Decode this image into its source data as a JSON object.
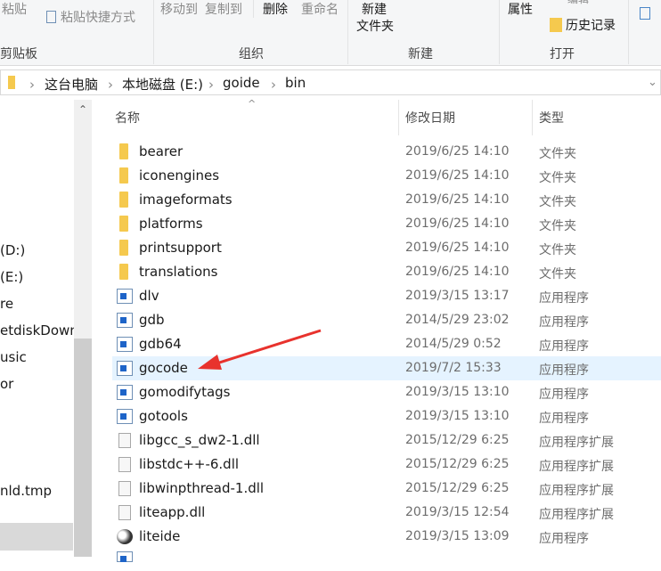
{
  "ribbon": {
    "paste": "粘贴",
    "paste_shortcut": "粘贴快捷方式",
    "move_to": "移动到",
    "copy_to": "复制到",
    "delete": "删除",
    "rename": "重命名",
    "new_folder_1": "新建",
    "new_folder_2": "文件夹",
    "properties": "属性",
    "edit": "编辑",
    "history": "历史记录",
    "groups": {
      "clipboard": "剪贴板",
      "organize": "组织",
      "new": "新建",
      "open": "打开"
    }
  },
  "address": {
    "crumbs": [
      "这台电脑",
      "本地磁盘 (E:)",
      "goide",
      "bin"
    ]
  },
  "nav": {
    "items": [
      "(D:)",
      "(E:)",
      "re",
      "etdiskDown",
      "usic",
      "or",
      "nld.tmp"
    ]
  },
  "columns": {
    "name": "名称",
    "date": "修改日期",
    "type": "类型"
  },
  "files": [
    {
      "name": "bearer",
      "date": "2019/6/25 14:10",
      "type": "文件夹",
      "icon": "folder"
    },
    {
      "name": "iconengines",
      "date": "2019/6/25 14:10",
      "type": "文件夹",
      "icon": "folder"
    },
    {
      "name": "imageformats",
      "date": "2019/6/25 14:10",
      "type": "文件夹",
      "icon": "folder"
    },
    {
      "name": "platforms",
      "date": "2019/6/25 14:10",
      "type": "文件夹",
      "icon": "folder"
    },
    {
      "name": "printsupport",
      "date": "2019/6/25 14:10",
      "type": "文件夹",
      "icon": "folder"
    },
    {
      "name": "translations",
      "date": "2019/6/25 14:10",
      "type": "文件夹",
      "icon": "folder"
    },
    {
      "name": "dlv",
      "date": "2019/3/15 13:17",
      "type": "应用程序",
      "icon": "exe"
    },
    {
      "name": "gdb",
      "date": "2014/5/29 23:02",
      "type": "应用程序",
      "icon": "exe"
    },
    {
      "name": "gdb64",
      "date": "2014/5/29 0:52",
      "type": "应用程序",
      "icon": "exe"
    },
    {
      "name": "gocode",
      "date": "2019/7/2 15:33",
      "type": "应用程序",
      "icon": "exe",
      "highlighted": true
    },
    {
      "name": "gomodifytags",
      "date": "2019/3/15 13:10",
      "type": "应用程序",
      "icon": "exe"
    },
    {
      "name": "gotools",
      "date": "2019/3/15 13:10",
      "type": "应用程序",
      "icon": "exe"
    },
    {
      "name": "libgcc_s_dw2-1.dll",
      "date": "2015/12/29 6:25",
      "type": "应用程序扩展",
      "icon": "dll"
    },
    {
      "name": "libstdc++-6.dll",
      "date": "2015/12/29 6:25",
      "type": "应用程序扩展",
      "icon": "dll"
    },
    {
      "name": "libwinpthread-1.dll",
      "date": "2015/12/29 6:25",
      "type": "应用程序扩展",
      "icon": "dll"
    },
    {
      "name": "liteapp.dll",
      "date": "2019/3/15 12:54",
      "type": "应用程序扩展",
      "icon": "dll"
    },
    {
      "name": "liteide",
      "date": "2019/3/15 13:09",
      "type": "应用程序",
      "icon": "yin-yang"
    }
  ],
  "colors": {
    "highlight": "#e5f3ff",
    "arrow": "#e8322d",
    "folder": "#f5c94e"
  }
}
